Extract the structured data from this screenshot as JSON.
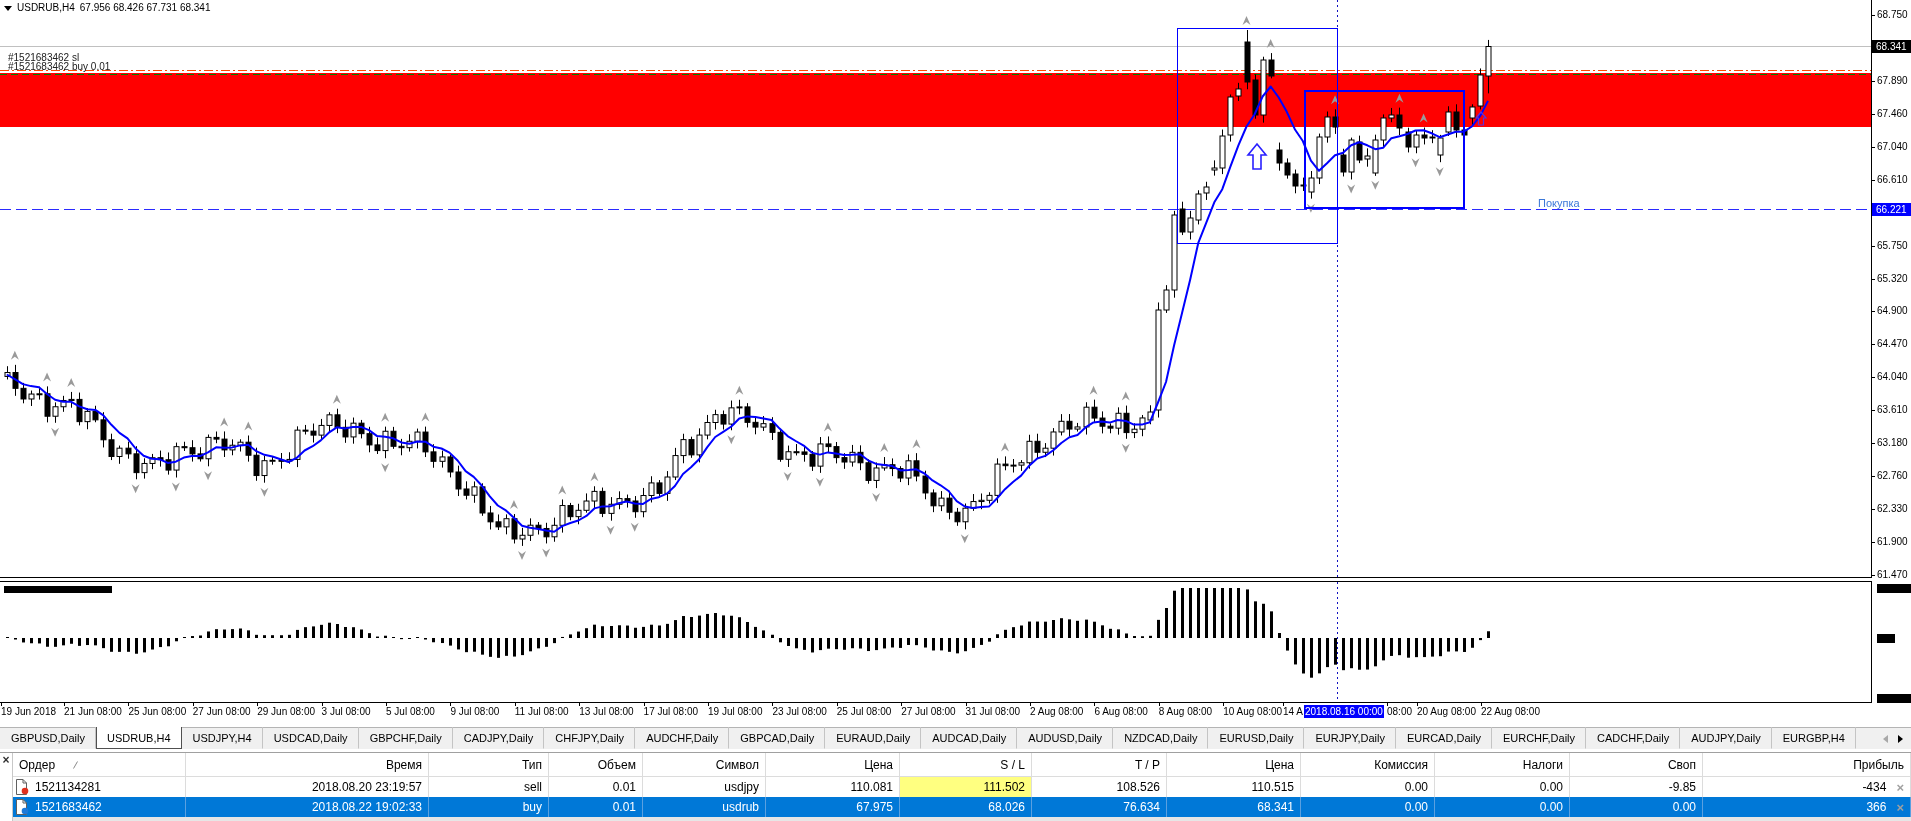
{
  "chart": {
    "symbol": "USDRUB,H4",
    "ohlc": "67.956 68.426 67.731 68.341",
    "order_labels": [
      "#1521683462 sl",
      "#1521683462 buy 0.01"
    ],
    "level_label": "Покупка"
  },
  "price_axis": {
    "labels": [
      "68.750",
      "67.890",
      "67.460",
      "67.040",
      "66.610",
      "65.750",
      "65.320",
      "64.900",
      "64.470",
      "64.040",
      "63.610",
      "63.180",
      "62.760",
      "62.330",
      "61.900",
      "61.470"
    ],
    "bid_tag": "68.341",
    "level_tag": "66.221"
  },
  "time_axis": {
    "labels": [
      "19 Jun 2018",
      "21 Jun 08:00",
      "25 Jun 08:00",
      "27 Jun 08:00",
      "29 Jun 08:00",
      "3 Jul 08:00",
      "5 Jul 08:00",
      "9 Jul 08:00",
      "11 Jul 08:00",
      "13 Jul 08:00",
      "17 Jul 08:00",
      "19 Jul 08:00",
      "23 Jul 08:00",
      "25 Jul 08:00",
      "27 Jul 08:00",
      "31 Jul 08:00",
      "2 Aug 08:00",
      "6 Aug 08:00",
      "8 Aug 08:00",
      "10 Aug 08:00",
      "14 A",
      "08:00",
      "20 Aug 08:00",
      "22 Aug 08:00"
    ],
    "cursor_tag": "2018.08.16 00:00"
  },
  "tabs": [
    {
      "label": "GBPUSD,Daily",
      "selected": false
    },
    {
      "label": "USDRUB,H4",
      "selected": true
    },
    {
      "label": "USDJPY,H4",
      "selected": false
    },
    {
      "label": "USDCAD,Daily",
      "selected": false
    },
    {
      "label": "GBPCHF,Daily",
      "selected": false
    },
    {
      "label": "CADJPY,Daily",
      "selected": false
    },
    {
      "label": "CHFJPY,Daily",
      "selected": false
    },
    {
      "label": "AUDCHF,Daily",
      "selected": false
    },
    {
      "label": "GBPCAD,Daily",
      "selected": false
    },
    {
      "label": "EURAUD,Daily",
      "selected": false
    },
    {
      "label": "AUDCAD,Daily",
      "selected": false
    },
    {
      "label": "AUDUSD,Daily",
      "selected": false
    },
    {
      "label": "NZDCAD,Daily",
      "selected": false
    },
    {
      "label": "EURUSD,Daily",
      "selected": false
    },
    {
      "label": "EURJPY,Daily",
      "selected": false
    },
    {
      "label": "EURCAD,Daily",
      "selected": false
    },
    {
      "label": "EURCHF,Daily",
      "selected": false
    },
    {
      "label": "CADCHF,Daily",
      "selected": false
    },
    {
      "label": "AUDJPY,Daily",
      "selected": false
    },
    {
      "label": "EURGBP,H4",
      "selected": false
    }
  ],
  "tab_scroll": [
    {
      "kind": "left",
      "disabled": true
    },
    {
      "kind": "right",
      "disabled": false
    }
  ],
  "orders": {
    "panel_close": "×",
    "columns": [
      "Ордер",
      "Время",
      "Тип",
      "Объем",
      "Символ",
      "Цена",
      "S / L",
      "T / P",
      "Цена",
      "Комиссия",
      "Налоги",
      "Своп",
      "Прибыль"
    ],
    "rows": [
      {
        "cells": [
          "1521134281",
          "2018.08.20 23:19:57",
          "sell",
          "0.01",
          "usdjpy",
          "110.081",
          "111.502",
          "108.526",
          "110.515",
          "0.00",
          "0.00",
          "-9.85",
          "-434"
        ],
        "close": "×",
        "color": "#e0301e",
        "selected": false,
        "sl_alert": true
      },
      {
        "cells": [
          "1521683462",
          "2018.08.22 19:02:33",
          "buy",
          "0.01",
          "usdrub",
          "67.975",
          "68.026",
          "76.634",
          "68.341",
          "0.00",
          "0.00",
          "0.00",
          "366"
        ],
        "close": "×",
        "color": "#1e7ad8",
        "selected": true,
        "sl_alert": false
      }
    ]
  }
}
